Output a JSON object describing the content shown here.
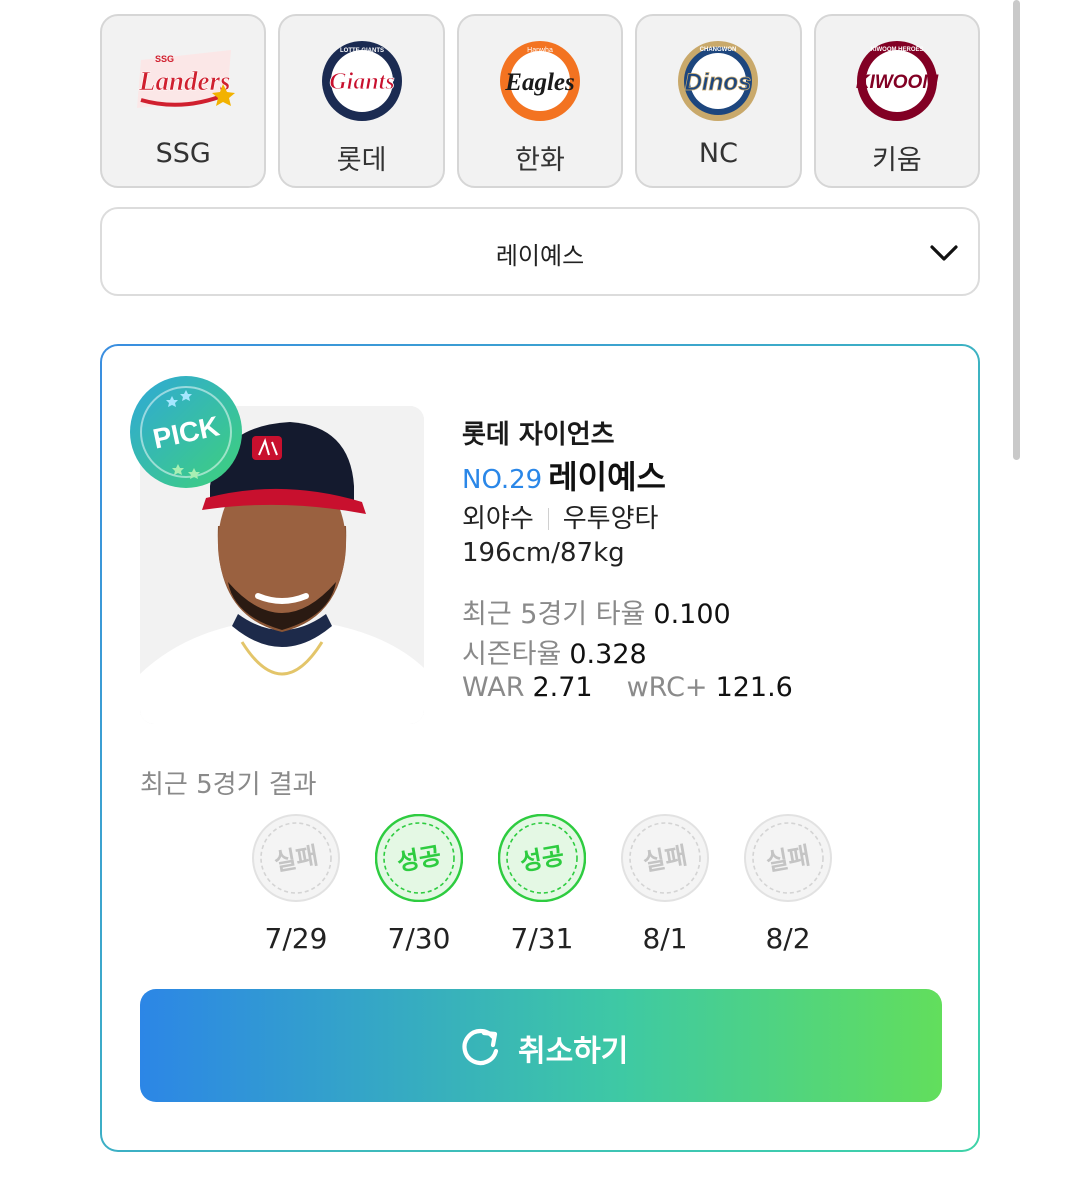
{
  "teams": [
    {
      "name": "SSG",
      "logo": "landers-logo",
      "logo_text": "Landers",
      "logo_top": "SSG",
      "color": "#d0202f"
    },
    {
      "name": "롯데",
      "logo": "giants-logo",
      "logo_text": "Giants",
      "logo_top": "LOTTE GIANTS",
      "color": "#c8102e"
    },
    {
      "name": "한화",
      "logo": "eagles-logo",
      "logo_text": "Eagles",
      "logo_top": "Hanwha",
      "color": "#f37321"
    },
    {
      "name": "NC",
      "logo": "dinos-logo",
      "logo_text": "Dinos",
      "logo_top": "CHANGWON",
      "color": "#1d467e"
    },
    {
      "name": "키움",
      "logo": "kiwoom-logo",
      "logo_text": "KIWOOM",
      "logo_top": "KIWOOM HEROES",
      "color": "#820024"
    }
  ],
  "player_select": {
    "value": "레이예스",
    "icon": "chevron-down-icon"
  },
  "pick_badge": "PICK",
  "player": {
    "team": "롯데 자이언츠",
    "number": "NO.29",
    "name": "레이예스",
    "position": "외야수",
    "bats": "우투양타",
    "body": "196cm/87kg",
    "stats": {
      "recent_avg_label": "최근 5경기 타율",
      "recent_avg": "0.100",
      "season_avg_label": "시즌타율",
      "season_avg": "0.328",
      "war_label": "WAR",
      "war": "2.71",
      "wrc_label": "wRC+",
      "wrc": "121.6"
    }
  },
  "recent": {
    "title": "최근 5경기 결과",
    "games": [
      {
        "result": "실패",
        "date": "7/29",
        "success": false
      },
      {
        "result": "성공",
        "date": "7/30",
        "success": true
      },
      {
        "result": "성공",
        "date": "7/31",
        "success": true
      },
      {
        "result": "실패",
        "date": "8/1",
        "success": false
      },
      {
        "result": "실패",
        "date": "8/2",
        "success": false
      }
    ]
  },
  "cancel_button": {
    "label": "취소하기",
    "icon": "refresh-icon"
  },
  "colors": {
    "accent_blue": "#2a87e8",
    "success_green": "#2ecc40",
    "fail_gray": "#bdbdbd"
  }
}
